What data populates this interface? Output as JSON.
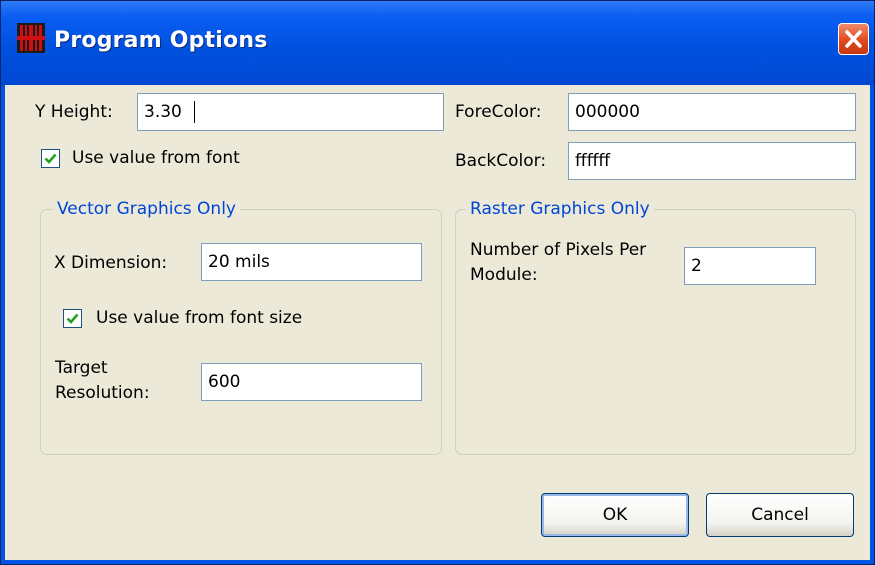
{
  "window": {
    "title": "Program Options",
    "icon": "barcode-app-icon",
    "close_icon": "close-icon"
  },
  "colors": {
    "titlebar": "#0054e3",
    "dialog_bg": "#ece9d8",
    "group_title": "#0046d5",
    "close_button": "#e04a1e",
    "checkbox_check": "#21a121"
  },
  "form": {
    "y_height_label": "Y Height:",
    "y_height_value": "3.30",
    "use_font_label": "Use value from font",
    "use_font_checked": true,
    "forecolor_label": "ForeColor:",
    "forecolor_value": "000000",
    "backcolor_label": "BackColor:",
    "backcolor_value": "ffffff"
  },
  "vector_group": {
    "title": "Vector Graphics Only",
    "x_dimension_label": "X Dimension:",
    "x_dimension_value": "20 mils",
    "use_font_size_label": "Use value from font size",
    "use_font_size_checked": true,
    "target_resolution_label_1": "Target",
    "target_resolution_label_2": "Resolution:",
    "target_resolution_value": "600"
  },
  "raster_group": {
    "title": "Raster Graphics Only",
    "pixels_label_1": "Number of Pixels Per",
    "pixels_label_2": "Module:",
    "pixels_value": "2"
  },
  "buttons": {
    "ok": "OK",
    "cancel": "Cancel"
  }
}
